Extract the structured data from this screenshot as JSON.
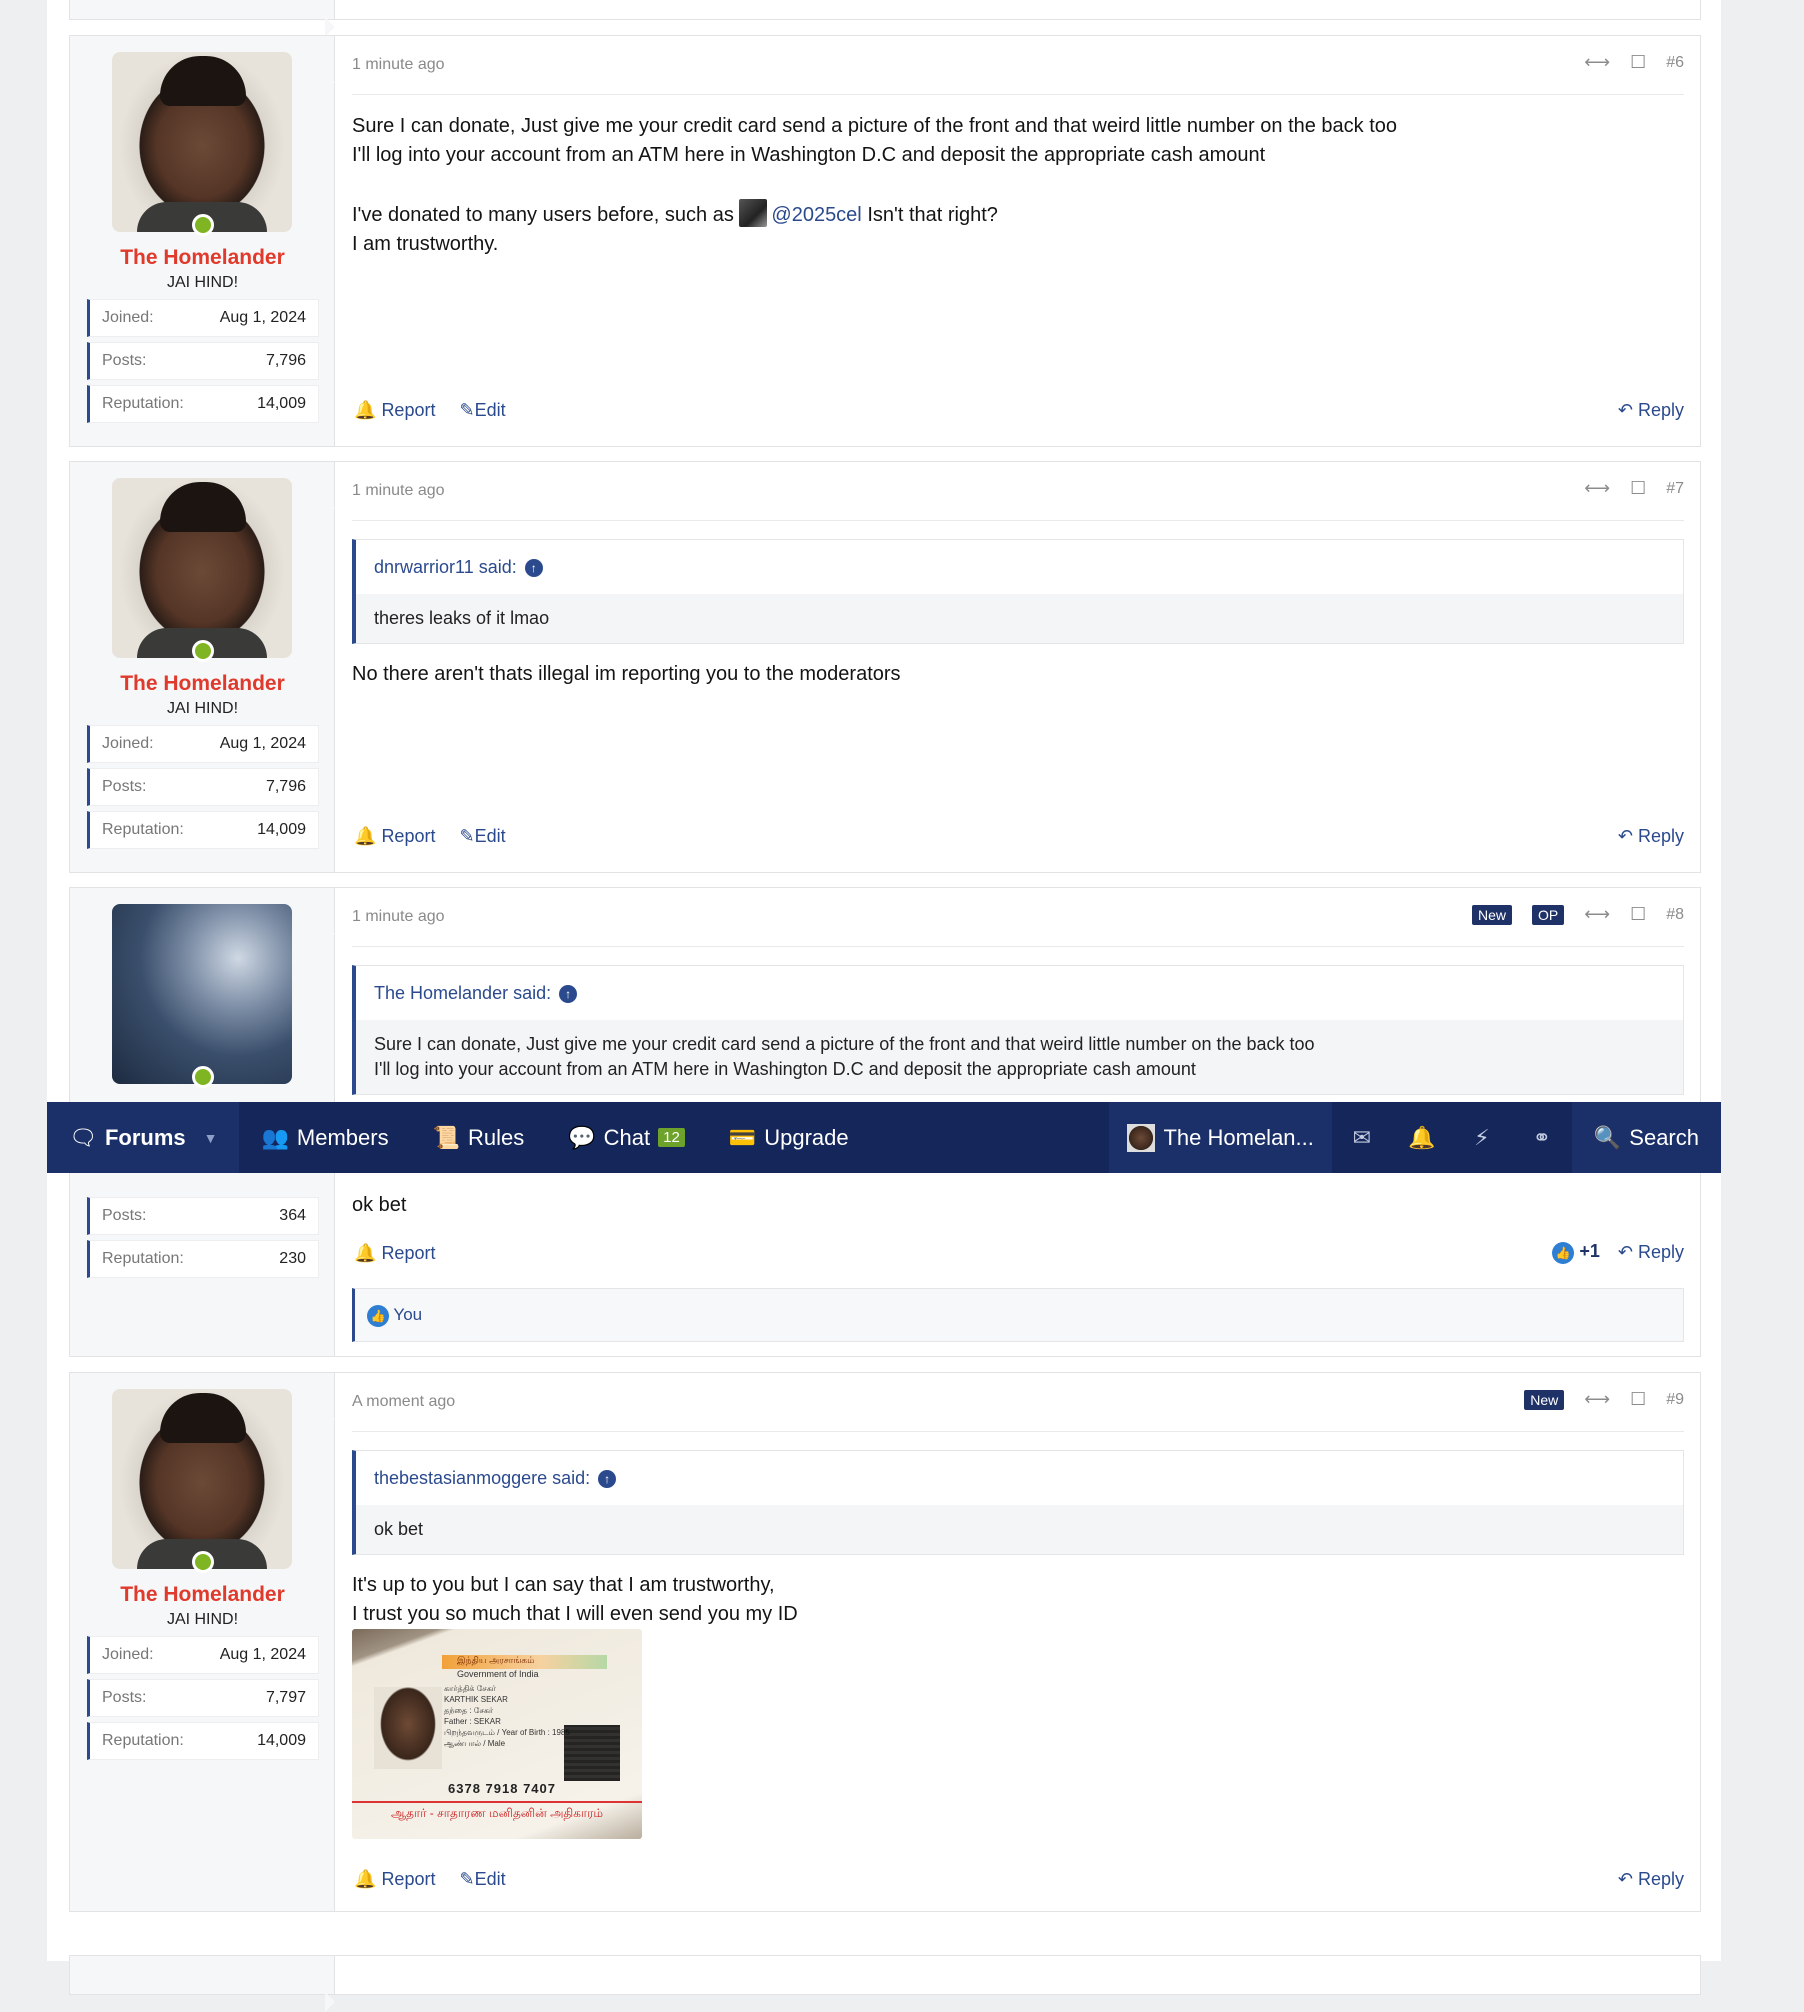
{
  "nav": {
    "forums": "Forums",
    "members": "Members",
    "rules": "Rules",
    "chat": "Chat",
    "chat_count": "12",
    "upgrade": "Upgrade",
    "user": "The Homelan...",
    "search": "Search"
  },
  "actions": {
    "report": "Report",
    "edit": "Edit",
    "reply": "Reply",
    "new": "New",
    "op": "OP"
  },
  "stats_labels": {
    "joined": "Joined:",
    "posts": "Posts:",
    "reputation": "Reputation:"
  },
  "posts": [
    {
      "time": "1 minute ago",
      "num": "#6",
      "author": "The Homelander",
      "author_title": "JAI HIND!",
      "joined": "Aug 1, 2024",
      "posts": "7,796",
      "reputation": "14,009",
      "line1": "Sure I can donate, Just give me your credit card send a picture of the front and that weird little number on the back too",
      "line2": "I'll log into your account from an ATM here in Washington D.C and deposit the appropriate cash amount",
      "line3_pre": "I've donated to many users before, such as",
      "mention": "@2025cel",
      "line3_post": "Isn't that right?",
      "line4": "I am trustworthy."
    },
    {
      "time": "1 minute ago",
      "num": "#7",
      "author": "The Homelander",
      "author_title": "JAI HIND!",
      "joined": "Aug 1, 2024",
      "posts": "7,796",
      "reputation": "14,009",
      "quote_author": "dnrwarrior11 said:",
      "quote_text": "theres leaks of it lmao",
      "text": "No there aren't thats illegal im reporting you to the moderators"
    },
    {
      "time": "1 minute ago",
      "num": "#8",
      "posts": "364",
      "reputation": "230",
      "quote_author": "The Homelander said:",
      "quote_line1": "Sure I can donate, Just give me your credit card send a picture of the front and that weird little number on the back too",
      "quote_line2": "I'll log into your account from an ATM here in Washington D.C and deposit the appropriate cash amount",
      "text": "ok bet",
      "likes": "+1",
      "liked_by": "You"
    },
    {
      "time": "A moment ago",
      "num": "#9",
      "author": "The Homelander",
      "author_title": "JAI HIND!",
      "joined": "Aug 1, 2024",
      "posts": "7,797",
      "reputation": "14,009",
      "quote_author": "thebestasianmoggere said:",
      "quote_text": "ok bet",
      "line1": "It's up to you but I can say that I am trustworthy,",
      "line2": "I trust you so much that I will even send you my ID",
      "id_card": {
        "header": "இந்திய அரசாங்கம்",
        "gov": "Government of India",
        "details": [
          "கார்த்திக் சேகர்",
          "KARTHIK SEKAR",
          "தந்தை : சேகர்",
          "Father : SEKAR",
          "பிறந்தவருடம் / Year of Birth : 1985",
          "ஆண்பால் / Male"
        ],
        "number": "6378 7918 7407",
        "footer": "ஆதார் - சாதாரண மனிதனின் அதிகாரம்"
      }
    }
  ]
}
